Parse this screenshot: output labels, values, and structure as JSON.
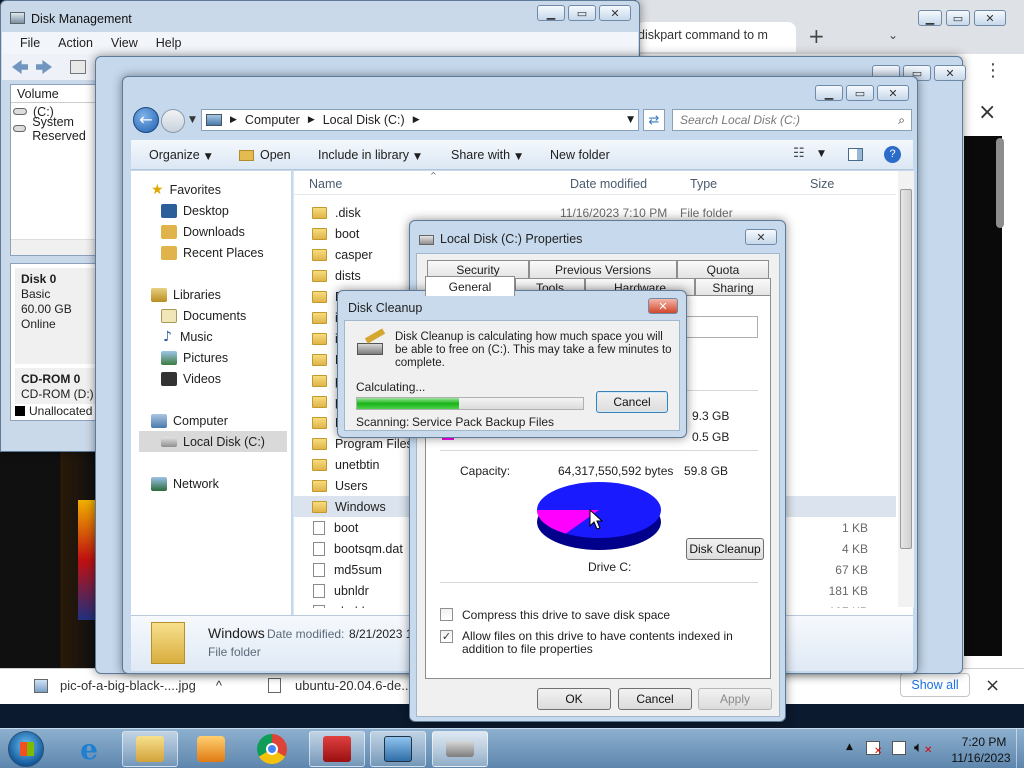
{
  "disk_mgmt": {
    "title": "Disk Management",
    "menu": [
      "File",
      "Action",
      "View",
      "Help"
    ],
    "volume_header": "Volume",
    "volumes": [
      "(C:)",
      "System Reserved"
    ],
    "disk0": {
      "name": "Disk 0",
      "type": "Basic",
      "size": "60.00 GB",
      "status": "Online"
    },
    "cdrom": {
      "name": "CD-ROM 0",
      "drive": "CD-ROM (D:)"
    },
    "legend": {
      "unallocated": "Unallocated",
      "primary": "P"
    }
  },
  "browser": {
    "tab_title": "diskpart command to m",
    "new_tab": "+",
    "menu_icon": "⋮",
    "close": "×",
    "downloads": [
      {
        "name": "pic-of-a-big-black-....jpg",
        "chevron": "^"
      },
      {
        "name": "ubuntu-20.04.6-de..."
      }
    ],
    "show_all": "Show all"
  },
  "explorer": {
    "breadcrumb": [
      "Computer",
      "Local Disk (C:)"
    ],
    "search_placeholder": "Search Local Disk (C:)",
    "toolbar": {
      "organize": "Organize",
      "open": "Open",
      "include": "Include in library",
      "share": "Share with",
      "new_folder": "New folder"
    },
    "nav": {
      "favorites": "Favorites",
      "favorites_items": [
        "Desktop",
        "Downloads",
        "Recent Places"
      ],
      "libraries": "Libraries",
      "libraries_items": [
        "Documents",
        "Music",
        "Pictures",
        "Videos"
      ],
      "computer": "Computer",
      "local_disk": "Local Disk (C:)",
      "network": "Network"
    },
    "columns": {
      "name": "Name",
      "date": "Date modified",
      "type": "Type",
      "size": "Size"
    },
    "files": [
      {
        "name": ".disk",
        "date": "11/16/2023 7:10 PM",
        "type": "File folder",
        "size": ""
      },
      {
        "name": "boot"
      },
      {
        "name": "casper"
      },
      {
        "name": "dists"
      },
      {
        "name": "EF"
      },
      {
        "name": "in"
      },
      {
        "name": "is"
      },
      {
        "name": "P"
      },
      {
        "name": "p"
      },
      {
        "name": "p"
      },
      {
        "name": "P"
      },
      {
        "name": "Program Files (x"
      },
      {
        "name": "unetbtin"
      },
      {
        "name": "Users"
      },
      {
        "name": "Windows"
      },
      {
        "name": "boot",
        "size": "1 KB",
        "type": "..."
      },
      {
        "name": "bootsqm.dat",
        "size": "4 KB"
      },
      {
        "name": "md5sum",
        "size": "67 KB"
      },
      {
        "name": "ubnldr",
        "size": "181 KB"
      },
      {
        "name": "ubnldr",
        "size": "197 KB"
      }
    ],
    "details": {
      "name": "Windows",
      "date_label": "Date modified:",
      "date_value": "8/21/2023 1",
      "type": "File folder"
    }
  },
  "properties": {
    "title": "Local Disk (C:) Properties",
    "tabs_row1": [
      "Security",
      "Previous Versions",
      "Quota"
    ],
    "tabs_row2": [
      "General",
      "Tools",
      "Hardware",
      "Sharing"
    ],
    "used_gb": "9.3 GB",
    "free_gb": "0.5 GB",
    "capacity_label": "Capacity:",
    "capacity_bytes": "64,317,550,592 bytes",
    "capacity_gb": "59.8 GB",
    "drive_label": "Drive C:",
    "disk_cleanup": "Disk Cleanup",
    "compress": "Compress this drive to save disk space",
    "index": "Allow files on this drive to have contents indexed in addition to file properties",
    "ok": "OK",
    "cancel": "Cancel",
    "apply": "Apply",
    "used_fraction": 0.16,
    "colors": {
      "used": "#1a1aff",
      "free": "#ff00ff"
    }
  },
  "cleanup": {
    "title": "Disk Cleanup",
    "message": "Disk Cleanup is calculating how much space you will be able to free on  (C:). This may take a few minutes to complete.",
    "status": "Calculating...",
    "progress": 0.45,
    "cancel": "Cancel",
    "scanning_label": "Scanning:",
    "scanning_value": "Service Pack Backup Files"
  },
  "taskbar": {
    "time": "7:20 PM",
    "date": "11/16/2023"
  }
}
